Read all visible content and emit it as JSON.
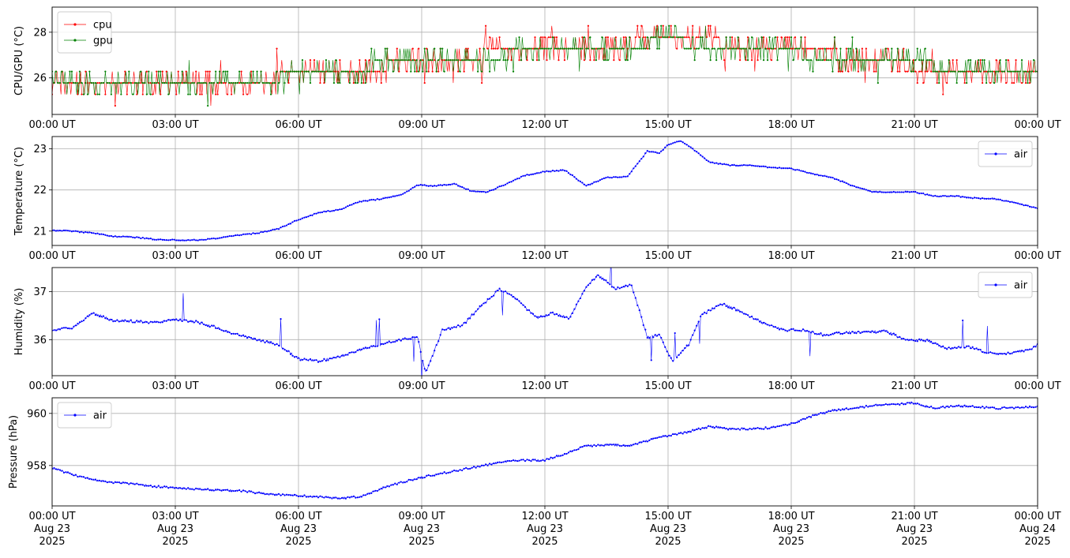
{
  "chart_data": [
    {
      "type": "line",
      "ylabel": "CPU/GPU (°C)",
      "ylim": [
        24.4,
        29.1
      ],
      "yticks": [
        26,
        28
      ],
      "x_ticks": [
        "00:00 UT",
        "03:00 UT",
        "06:00 UT",
        "09:00 UT",
        "12:00 UT",
        "15:00 UT",
        "18:00 UT",
        "21:00 UT",
        "00:00 UT"
      ],
      "grid": true,
      "legend": "upper left",
      "series": [
        {
          "name": "cpu",
          "color": "#ff0000",
          "markers": true,
          "x_hours": [
            0,
            1,
            2,
            3,
            4,
            5,
            5.9,
            6.5,
            7,
            8,
            8.6,
            9,
            10,
            11,
            11.7,
            12,
            12.8,
            13.5,
            14.3,
            15,
            15.5,
            16,
            17,
            18,
            19,
            20,
            21,
            22,
            23,
            24
          ],
          "y": [
            26.2,
            26.2,
            26.2,
            26.2,
            26.2,
            26.2,
            26.3,
            26.4,
            26.7,
            26.7,
            26.9,
            27.1,
            27.2,
            27.3,
            27.6,
            27.8,
            27.6,
            27.5,
            27.8,
            27.9,
            27.9,
            27.8,
            27.6,
            27.5,
            27.3,
            26.9,
            26.7,
            26.7,
            26.6,
            26.6
          ]
        },
        {
          "name": "gpu",
          "color": "#008000",
          "markers": true,
          "x_hours": [
            0,
            1,
            2,
            3,
            4,
            5,
            5.9,
            6.5,
            7,
            8,
            8.6,
            9,
            10,
            11,
            11.7,
            12,
            12.8,
            13.5,
            14.3,
            15,
            15.5,
            16,
            17,
            18,
            19,
            20,
            21,
            22,
            23,
            24
          ],
          "y": [
            26.0,
            25.9,
            26.0,
            26.0,
            26.0,
            26.0,
            26.4,
            26.5,
            26.6,
            26.8,
            26.8,
            27.0,
            27.1,
            27.2,
            27.5,
            27.6,
            27.4,
            27.3,
            27.7,
            27.9,
            27.7,
            27.5,
            27.4,
            27.3,
            27.1,
            26.9,
            26.8,
            26.7,
            26.6,
            26.6
          ]
        }
      ]
    },
    {
      "type": "line",
      "ylabel": "Temperature (°C)",
      "ylim": [
        20.65,
        23.3
      ],
      "yticks": [
        21,
        22,
        23
      ],
      "x_ticks": [
        "00:00 UT",
        "03:00 UT",
        "06:00 UT",
        "09:00 UT",
        "12:00 UT",
        "15:00 UT",
        "18:00 UT",
        "21:00 UT",
        "00:00 UT"
      ],
      "grid": true,
      "legend": "upper right",
      "series": [
        {
          "name": "air",
          "color": "#0000ff",
          "markers": true,
          "x_hours": [
            0,
            0.5,
            1,
            1.5,
            2,
            2.5,
            3,
            3.5,
            4,
            4.5,
            5,
            5.5,
            6,
            6.5,
            7,
            7.5,
            8,
            8.5,
            8.9,
            9.3,
            9.8,
            10.2,
            10.6,
            11,
            11.5,
            12,
            12.5,
            13,
            13.5,
            14,
            14.5,
            14.8,
            15,
            15.3,
            15.6,
            16,
            16.5,
            17,
            17.5,
            18,
            18.5,
            19,
            19.5,
            20,
            20.5,
            21,
            21.5,
            22,
            22.5,
            23,
            23.5,
            24
          ],
          "y": [
            21.02,
            21.0,
            20.95,
            20.87,
            20.85,
            20.8,
            20.78,
            20.78,
            20.82,
            20.9,
            20.95,
            21.05,
            21.28,
            21.45,
            21.52,
            21.72,
            21.78,
            21.88,
            22.12,
            22.1,
            22.15,
            21.98,
            21.95,
            22.12,
            22.35,
            22.45,
            22.48,
            22.1,
            22.3,
            22.32,
            22.95,
            22.9,
            23.1,
            23.2,
            23.0,
            22.68,
            22.6,
            22.6,
            22.55,
            22.52,
            22.4,
            22.3,
            22.1,
            21.95,
            21.95,
            21.95,
            21.85,
            21.85,
            21.8,
            21.78,
            21.68,
            21.55
          ]
        }
      ]
    },
    {
      "type": "line",
      "ylabel": "Humidity (%)",
      "ylim": [
        35.25,
        37.5
      ],
      "yticks": [
        36,
        37
      ],
      "x_ticks": [
        "00:00 UT",
        "03:00 UT",
        "06:00 UT",
        "09:00 UT",
        "12:00 UT",
        "15:00 UT",
        "18:00 UT",
        "21:00 UT",
        "00:00 UT"
      ],
      "grid": true,
      "legend": "upper right",
      "series": [
        {
          "name": "air",
          "color": "#0000ff",
          "markers": true,
          "x_hours": [
            0,
            0.5,
            1,
            1.5,
            2,
            2.5,
            3,
            3.5,
            4,
            4.5,
            5,
            5.5,
            6,
            6.5,
            7,
            7.5,
            8,
            8.5,
            8.9,
            9.1,
            9.5,
            10,
            10.5,
            10.9,
            11.3,
            11.8,
            12.2,
            12.6,
            13,
            13.3,
            13.7,
            14.1,
            14.5,
            14.8,
            15.1,
            15.5,
            15.8,
            16.3,
            16.8,
            17.3,
            17.8,
            18.3,
            18.8,
            19.3,
            19.8,
            20.3,
            20.8,
            21.3,
            21.8,
            22.3,
            22.8,
            23.3,
            23.8,
            24
          ],
          "y": [
            36.2,
            36.25,
            36.55,
            36.4,
            36.38,
            36.35,
            36.42,
            36.38,
            36.25,
            36.1,
            36.0,
            35.9,
            35.6,
            35.55,
            35.65,
            35.78,
            35.9,
            36.0,
            36.05,
            35.3,
            36.2,
            36.3,
            36.75,
            37.05,
            36.85,
            36.45,
            36.55,
            36.45,
            37.1,
            37.35,
            37.05,
            37.15,
            36.05,
            36.1,
            35.55,
            35.9,
            36.5,
            36.75,
            36.58,
            36.35,
            36.2,
            36.2,
            36.1,
            36.15,
            36.15,
            36.18,
            36.0,
            35.98,
            35.82,
            35.85,
            35.72,
            35.72,
            35.78,
            35.9
          ]
        }
      ]
    },
    {
      "type": "line",
      "ylabel": "Pressure (hPa)",
      "ylim": [
        956.45,
        960.6
      ],
      "yticks": [
        958,
        960
      ],
      "x_ticks": [
        "00:00 UT\nAug 23\n2025",
        "03:00 UT\nAug 23\n2025",
        "06:00 UT\nAug 23\n2025",
        "09:00 UT\nAug 23\n2025",
        "12:00 UT\nAug 23\n2025",
        "15:00 UT\nAug 23\n2025",
        "18:00 UT\nAug 23\n2025",
        "21:00 UT\nAug 23\n2025",
        "00:00 UT\nAug 24\n2025"
      ],
      "grid": true,
      "legend": "upper left",
      "series": [
        {
          "name": "air",
          "color": "#0000ff",
          "markers": true,
          "x_hours": [
            0,
            0.5,
            1,
            1.5,
            2,
            2.5,
            3,
            3.5,
            4,
            4.5,
            5,
            5.5,
            6,
            6.5,
            7,
            7.5,
            8,
            8.5,
            9,
            9.5,
            10,
            10.5,
            11,
            11.5,
            12,
            12.5,
            13,
            13.5,
            14,
            14.5,
            15,
            15.5,
            16,
            16.5,
            17,
            17.5,
            18,
            18.5,
            19,
            19.5,
            20,
            20.5,
            21,
            21.5,
            22,
            22.5,
            23,
            23.5,
            24
          ],
          "y": [
            957.9,
            957.65,
            957.45,
            957.35,
            957.3,
            957.2,
            957.15,
            957.1,
            957.05,
            957.05,
            956.95,
            956.88,
            956.85,
            956.8,
            956.75,
            956.8,
            957.1,
            957.35,
            957.55,
            957.7,
            957.85,
            958.0,
            958.15,
            958.2,
            958.2,
            958.45,
            958.75,
            958.8,
            958.75,
            958.95,
            959.15,
            959.3,
            959.5,
            959.4,
            959.4,
            959.45,
            959.6,
            959.9,
            960.1,
            960.2,
            960.3,
            960.35,
            960.4,
            960.2,
            960.3,
            960.25,
            960.2,
            960.22,
            960.25
          ]
        }
      ]
    }
  ]
}
